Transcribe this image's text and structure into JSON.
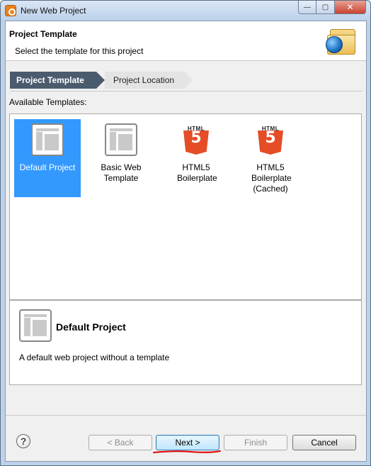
{
  "window": {
    "title": "New Web Project",
    "min_symbol": "—",
    "max_symbol": "▢",
    "close_symbol": "✕"
  },
  "banner": {
    "title": "Project Template",
    "description": "Select the template for this project",
    "icon": "folder-globe-icon"
  },
  "steps": [
    {
      "label": "Project Template",
      "active": true
    },
    {
      "label": "Project Location",
      "active": false
    }
  ],
  "templates_label": "Available Templates:",
  "templates": [
    {
      "label": "Default Project",
      "icon": "page-layout-icon",
      "selected": true
    },
    {
      "label": "Basic Web Template",
      "icon": "page-layout-icon",
      "selected": false
    },
    {
      "label": "HTML5 Boilerplate",
      "icon": "html5-icon",
      "selected": false
    },
    {
      "label": "HTML5 Boilerplate (Cached)",
      "icon": "html5-icon",
      "selected": false
    }
  ],
  "html5_word": "HTML",
  "html5_num": "5",
  "selection": {
    "title": "Default Project",
    "description": "A default web project without a template"
  },
  "buttons": {
    "help": "?",
    "back": "< Back",
    "next": "Next >",
    "finish": "Finish",
    "cancel": "Cancel"
  },
  "colors": {
    "selection": "#3399ff",
    "step_active": "#4b5b6e",
    "html5_orange": "#e44d26",
    "annotation_red": "#e00000"
  }
}
